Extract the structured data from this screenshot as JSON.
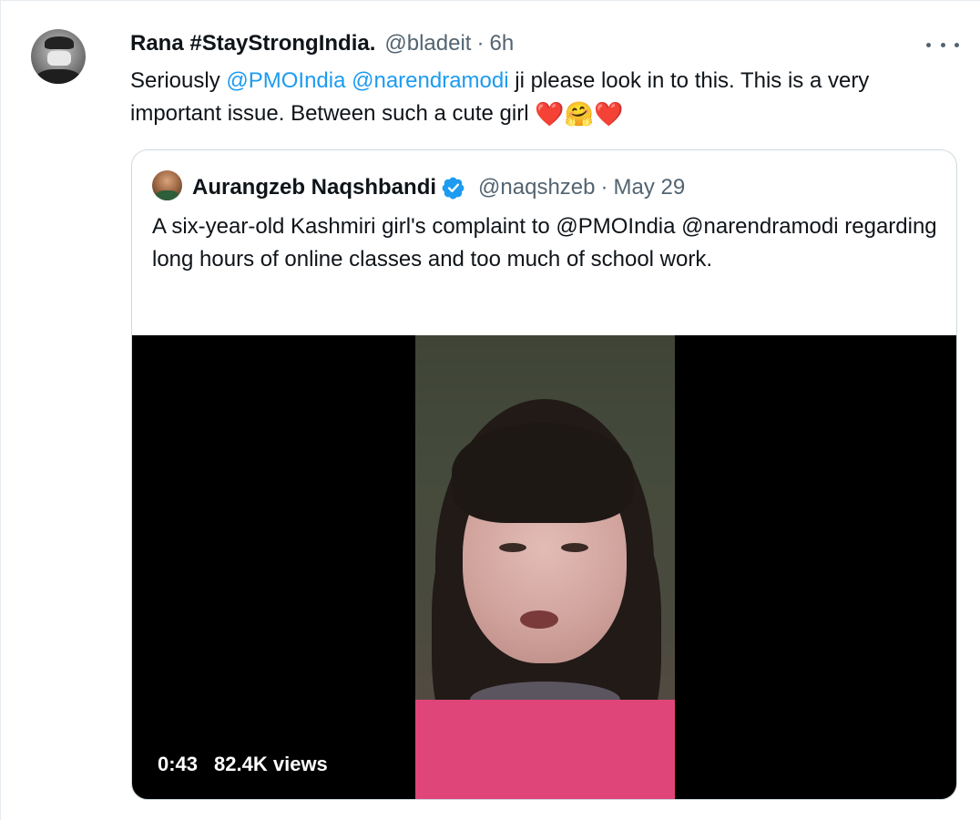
{
  "tweet": {
    "author_name": "Rana #StayStrongIndia.",
    "handle": "@bladeit",
    "separator": "·",
    "time": "6h",
    "text_parts": {
      "p1": "Seriously ",
      "m1": "@PMOIndia",
      "p2": " ",
      "m2": "@narendramodi",
      "p3": " ji please look in to this. This is a very important issue. Between such a cute girl "
    },
    "emojis": [
      "❤️",
      "🤗",
      "❤️"
    ]
  },
  "quote": {
    "author_name": "Aurangzeb Naqshbandi",
    "verified": true,
    "handle": "@naqshzeb",
    "separator": "·",
    "date": "May 29",
    "text": "A six-year-old Kashmiri girl's complaint to @PMOIndia @narendramodi regarding long hours of online classes and too much of school work.",
    "video": {
      "duration": "0:43",
      "views": "82.4K views"
    }
  },
  "colors": {
    "link": "#1d9bf0",
    "muted": "#536471",
    "text": "#0f1419",
    "border": "#cfd9de"
  },
  "icons": [
    "more-icon",
    "verified-badge-icon"
  ]
}
